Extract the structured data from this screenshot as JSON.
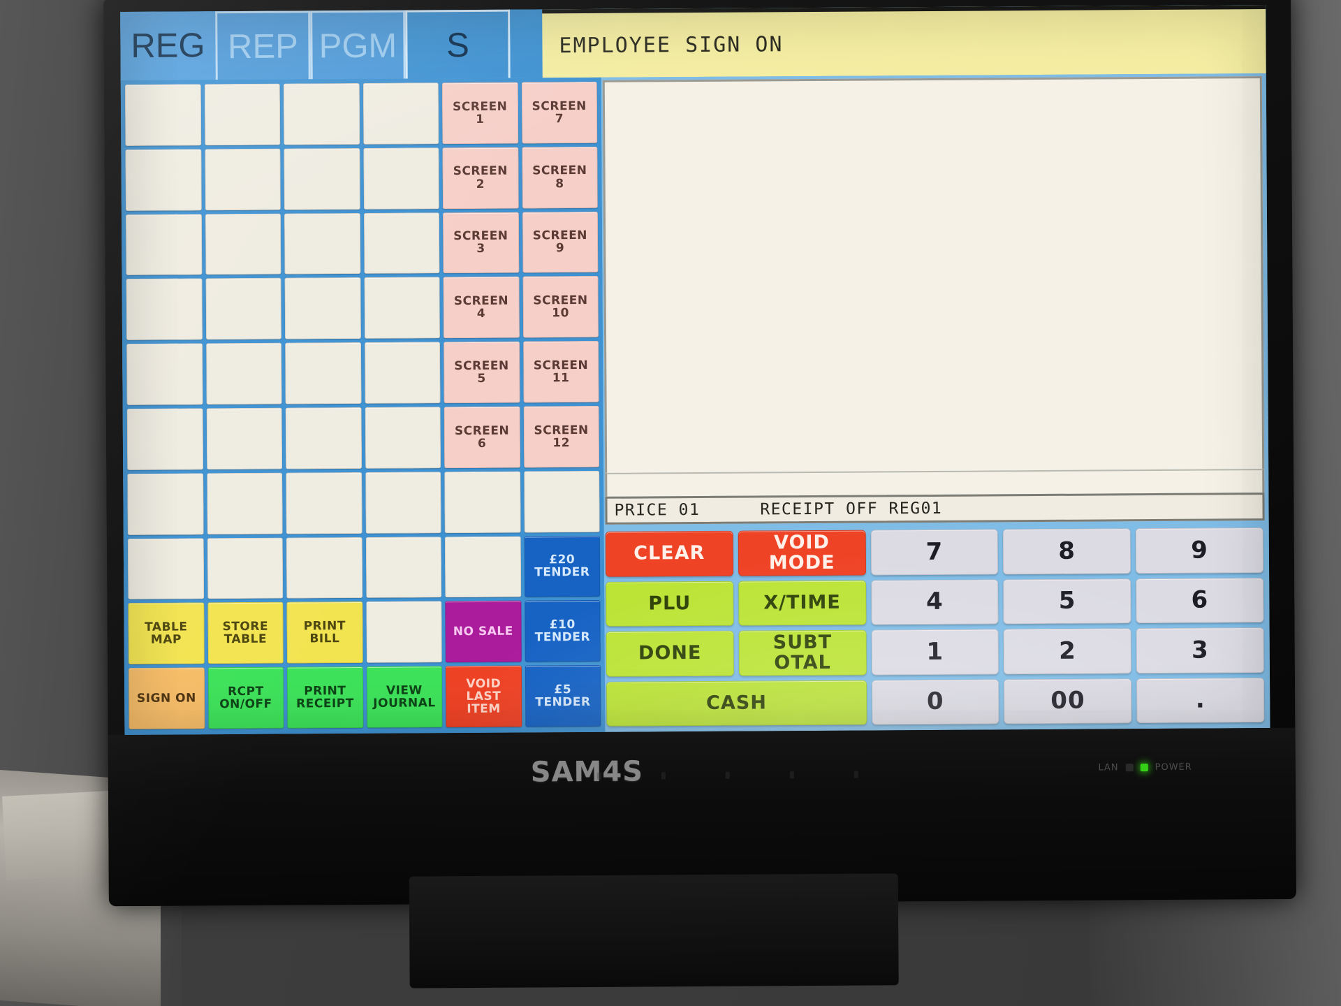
{
  "device": {
    "brand": "SAM4S",
    "lan_label": "LAN",
    "power_label": "POWER"
  },
  "modebar": {
    "tabs": [
      {
        "label": "REG",
        "state": "active"
      },
      {
        "label": "REP",
        "state": "inactive"
      },
      {
        "label": "PGM",
        "state": "inactive"
      },
      {
        "label": "S",
        "state": "sel"
      }
    ],
    "status_text": "EMPLOYEE SIGN ON"
  },
  "display": {
    "receipt_lines": [],
    "info_left": "PRICE 01",
    "info_right": "RECEIPT OFF REG01"
  },
  "keymatrix": {
    "rows": 10,
    "cols": 6,
    "keys": [
      {
        "label": "",
        "type": "blank"
      },
      {
        "label": "",
        "type": "blank"
      },
      {
        "label": "",
        "type": "blank"
      },
      {
        "label": "",
        "type": "blank"
      },
      {
        "label": "SCREEN\n1",
        "type": "screen"
      },
      {
        "label": "SCREEN\n7",
        "type": "screen"
      },
      {
        "label": "",
        "type": "blank"
      },
      {
        "label": "",
        "type": "blank"
      },
      {
        "label": "",
        "type": "blank"
      },
      {
        "label": "",
        "type": "blank"
      },
      {
        "label": "SCREEN\n2",
        "type": "screen"
      },
      {
        "label": "SCREEN\n8",
        "type": "screen"
      },
      {
        "label": "",
        "type": "blank"
      },
      {
        "label": "",
        "type": "blank"
      },
      {
        "label": "",
        "type": "blank"
      },
      {
        "label": "",
        "type": "blank"
      },
      {
        "label": "SCREEN\n3",
        "type": "screen"
      },
      {
        "label": "SCREEN\n9",
        "type": "screen"
      },
      {
        "label": "",
        "type": "blank"
      },
      {
        "label": "",
        "type": "blank"
      },
      {
        "label": "",
        "type": "blank"
      },
      {
        "label": "",
        "type": "blank"
      },
      {
        "label": "SCREEN\n4",
        "type": "screen"
      },
      {
        "label": "SCREEN\n10",
        "type": "screen"
      },
      {
        "label": "",
        "type": "blank"
      },
      {
        "label": "",
        "type": "blank"
      },
      {
        "label": "",
        "type": "blank"
      },
      {
        "label": "",
        "type": "blank"
      },
      {
        "label": "SCREEN\n5",
        "type": "screen"
      },
      {
        "label": "SCREEN\n11",
        "type": "screen"
      },
      {
        "label": "",
        "type": "blank"
      },
      {
        "label": "",
        "type": "blank"
      },
      {
        "label": "",
        "type": "blank"
      },
      {
        "label": "",
        "type": "blank"
      },
      {
        "label": "SCREEN\n6",
        "type": "screen"
      },
      {
        "label": "SCREEN\n12",
        "type": "screen"
      },
      {
        "label": "",
        "type": "blank"
      },
      {
        "label": "",
        "type": "blank"
      },
      {
        "label": "",
        "type": "blank"
      },
      {
        "label": "",
        "type": "blank"
      },
      {
        "label": "",
        "type": "blank"
      },
      {
        "label": "",
        "type": "blank"
      },
      {
        "label": "",
        "type": "blank"
      },
      {
        "label": "",
        "type": "blank"
      },
      {
        "label": "",
        "type": "blank"
      },
      {
        "label": "",
        "type": "blank"
      },
      {
        "label": "",
        "type": "blank"
      },
      {
        "label": "£20\nTENDER",
        "type": "blue"
      },
      {
        "label": "TABLE\nMAP",
        "type": "yellow"
      },
      {
        "label": "STORE\nTABLE",
        "type": "yellow"
      },
      {
        "label": "PRINT\nBILL",
        "type": "yellow"
      },
      {
        "label": "",
        "type": "blank"
      },
      {
        "label": "NO SALE",
        "type": "magenta"
      },
      {
        "label": "£10\nTENDER",
        "type": "blue"
      },
      {
        "label": "SIGN ON",
        "type": "orange"
      },
      {
        "label": "RCPT\nON/OFF",
        "type": "green"
      },
      {
        "label": "PRINT\nRECEIPT",
        "type": "green"
      },
      {
        "label": "VIEW\nJOURNAL",
        "type": "green"
      },
      {
        "label": "VOID\nLAST\nITEM",
        "type": "red"
      },
      {
        "label": "£5\nTENDER",
        "type": "blue"
      }
    ]
  },
  "keypad": {
    "keys": [
      {
        "label": "CLEAR",
        "type": "red"
      },
      {
        "label": "VOID\nMODE",
        "type": "red"
      },
      {
        "label": "7",
        "type": "num"
      },
      {
        "label": "8",
        "type": "num"
      },
      {
        "label": "9",
        "type": "num"
      },
      {
        "label": "PLU",
        "type": "lime"
      },
      {
        "label": "X/TIME",
        "type": "lime"
      },
      {
        "label": "4",
        "type": "num"
      },
      {
        "label": "5",
        "type": "num"
      },
      {
        "label": "6",
        "type": "num"
      },
      {
        "label": "DONE",
        "type": "lime"
      },
      {
        "label": "SUBT\nOTAL",
        "type": "lime"
      },
      {
        "label": "1",
        "type": "num"
      },
      {
        "label": "2",
        "type": "num"
      },
      {
        "label": "3",
        "type": "num"
      },
      {
        "label": "CASH",
        "type": "lime",
        "span": 2
      },
      {
        "label": "0",
        "type": "num"
      },
      {
        "label": "00",
        "type": "num"
      },
      {
        "label": ".",
        "type": "num"
      }
    ]
  },
  "colors": {
    "screen_bg": "#7fbce6",
    "modebar_blue": "#3f92d2",
    "status_yellow": "#f4eda2",
    "screen_key_pink": "#f6cfc8",
    "tender_blue": "#1763c4",
    "lime": "#bbe436",
    "red": "#ef4326",
    "magenta": "#ab1c9c",
    "blank_key": "#efece1"
  }
}
